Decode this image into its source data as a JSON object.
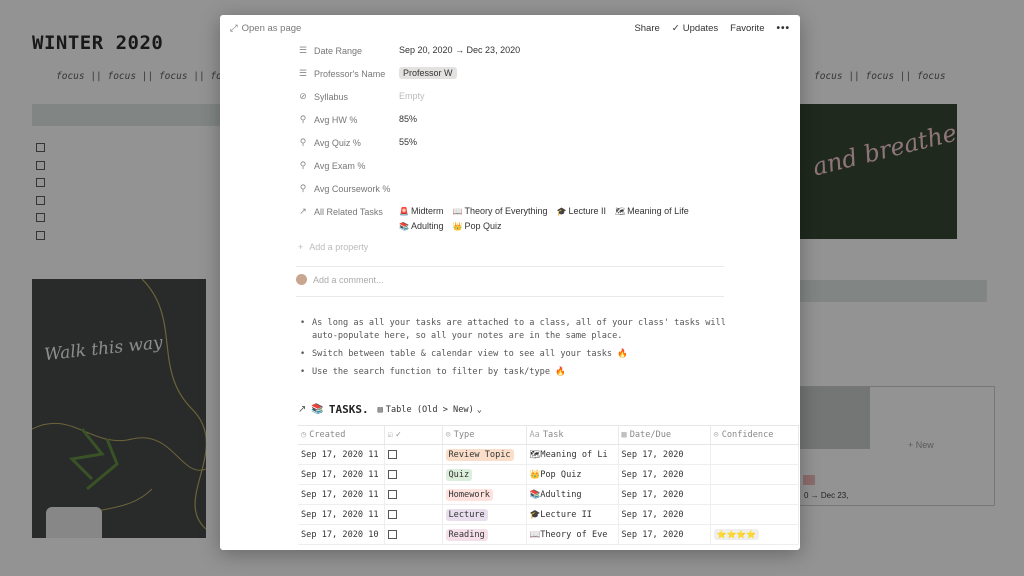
{
  "background": {
    "title": "WINTER 2020",
    "focus_text": "focus || focus || focus || focus",
    "focus_text_right": "focus || focus || focus",
    "left_image_text": "Walk this way",
    "right_image_text": "and breathe",
    "card_dates": "0 → Dec 23,",
    "new_label": "+ New"
  },
  "modal": {
    "open_as_page": "Open as page",
    "actions": {
      "share": "Share",
      "updates": "Updates",
      "favorite": "Favorite",
      "more": "•••"
    },
    "properties": {
      "date_range": {
        "label": "Date Range",
        "value": "Sep 20, 2020 → Dec 23, 2020",
        "icon": "☰"
      },
      "professor": {
        "label": "Professor's Name",
        "value": "Professor W",
        "icon": "☰"
      },
      "syllabus": {
        "label": "Syllabus",
        "value": "Empty",
        "icon": "⊘"
      },
      "avg_hw": {
        "label": "Avg HW %",
        "value": "85%",
        "icon": "⚲"
      },
      "avg_quiz": {
        "label": "Avg Quiz %",
        "value": "55%",
        "icon": "⚲"
      },
      "avg_exam": {
        "label": "Avg Exam %",
        "value": "",
        "icon": "⚲"
      },
      "avg_coursework": {
        "label": "Avg Coursework %",
        "value": "",
        "icon": "⚲"
      },
      "related": {
        "label": "All Related Tasks",
        "icon": "↗",
        "items": [
          {
            "emoji": "🚨",
            "label": "Midterm"
          },
          {
            "emoji": "📖",
            "label": "Theory of Everything"
          },
          {
            "emoji": "🎓",
            "label": "Lecture II"
          },
          {
            "emoji": "🗺",
            "label": "Meaning of Life"
          },
          {
            "emoji": "📚",
            "label": "Adulting"
          },
          {
            "emoji": "👑",
            "label": "Pop Quiz"
          }
        ]
      }
    },
    "add_property": "Add a property",
    "add_comment": "Add a comment...",
    "bullets": [
      "As long as all your tasks are attached to a class, all of your class' tasks will auto-populate here, so all your notes are in the same place.",
      "Switch between table & calendar view to see all your tasks 🔥",
      "Use the search function to filter by task/type 🔥"
    ],
    "tasks": {
      "title": "TASKS.",
      "view_label": "Table (Old > New)",
      "columns": {
        "created": "Created",
        "done": "✓",
        "type": "Type",
        "task": "Task",
        "date_due": "Date/Due",
        "confidence": "Confidence"
      },
      "rows": [
        {
          "created": "Sep 17, 2020 11",
          "type": "Review Topic",
          "type_class": "tag-review",
          "task_emoji": "🗺",
          "task": "Meaning of Li",
          "due": "Sep 17, 2020",
          "confidence": ""
        },
        {
          "created": "Sep 17, 2020 11",
          "type": "Quiz",
          "type_class": "tag-quiz",
          "task_emoji": "👑",
          "task": "Pop Quiz",
          "due": "Sep 17, 2020",
          "confidence": ""
        },
        {
          "created": "Sep 17, 2020 11",
          "type": "Homework",
          "type_class": "tag-hw",
          "task_emoji": "📚",
          "task": "Adulting",
          "due": "Sep 17, 2020",
          "confidence": ""
        },
        {
          "created": "Sep 17, 2020 11",
          "type": "Lecture",
          "type_class": "tag-lecture",
          "task_emoji": "🎓",
          "task": "Lecture II",
          "due": "Sep 17, 2020",
          "confidence": ""
        },
        {
          "created": "Sep 17, 2020 10",
          "type": "Reading",
          "type_class": "tag-reading",
          "task_emoji": "📖",
          "task": "Theory of Eve",
          "due": "Sep 17, 2020",
          "confidence": "⭐⭐⭐⭐"
        }
      ]
    }
  }
}
